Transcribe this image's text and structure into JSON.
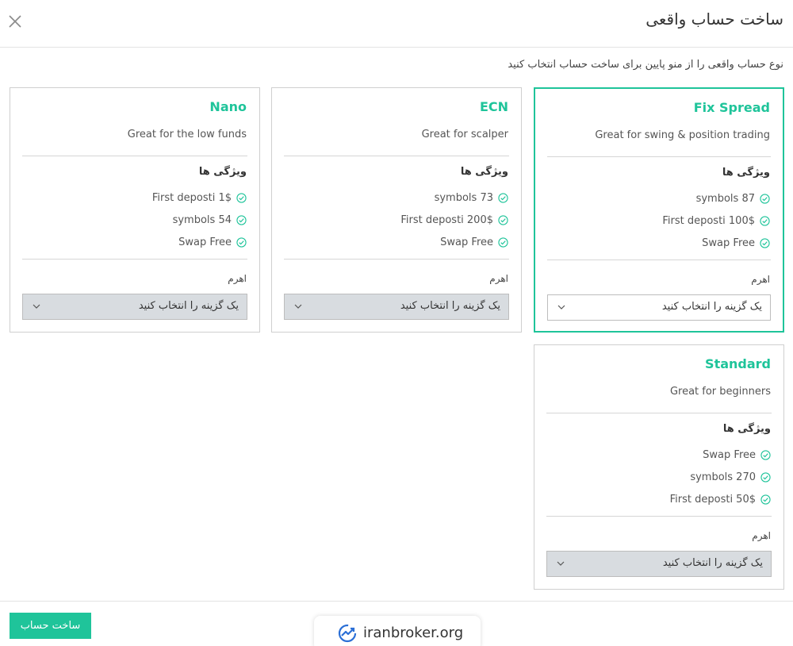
{
  "modal": {
    "title": "ساخت حساب واقعی",
    "subtitle": "نوع حساب واقعی را از منو پایین برای ساخت حساب انتخاب کنید",
    "submit_label": "ساخت حساب"
  },
  "cards": [
    {
      "name": "Fix Spread",
      "description": "Great for swing & position trading",
      "features_title": "ویژگی ها",
      "features": [
        "symbols 87",
        "First deposti 100$",
        "Swap Free"
      ],
      "leverage_label": "اهرم",
      "select_placeholder": "یک گزینه را انتخاب کنید",
      "selected": true
    },
    {
      "name": "ECN",
      "description": "Great for scalper",
      "features_title": "ویژگی ها",
      "features": [
        "symbols 73",
        "First deposti 200$",
        "Swap Free"
      ],
      "leverage_label": "اهرم",
      "select_placeholder": "یک گزینه را انتخاب کنید",
      "selected": false
    },
    {
      "name": "Nano",
      "description": "Great for the low funds",
      "features_title": "ویژگی ها",
      "features": [
        "First deposti 1$",
        "symbols 54",
        "Swap Free"
      ],
      "leverage_label": "اهرم",
      "select_placeholder": "یک گزینه را انتخاب کنید",
      "selected": false
    },
    {
      "name": "Standard",
      "description": "Great for beginners",
      "features_title": "ویژگی ها",
      "features": [
        "Swap Free",
        "symbols 270",
        "First deposti 50$"
      ],
      "leverage_label": "اهرم",
      "select_placeholder": "یک گزینه را انتخاب کنید",
      "selected": false
    }
  ],
  "watermark": {
    "text": "iranbroker.org",
    "icon": "iranbroker-logo-icon"
  },
  "icons": {
    "close": "close-icon",
    "check": "check-circle-icon",
    "chevron": "chevron-down-icon"
  },
  "colors": {
    "accent": "#1fc49a",
    "select_bg": "#d8dce0",
    "border": "#cfcfcf"
  }
}
